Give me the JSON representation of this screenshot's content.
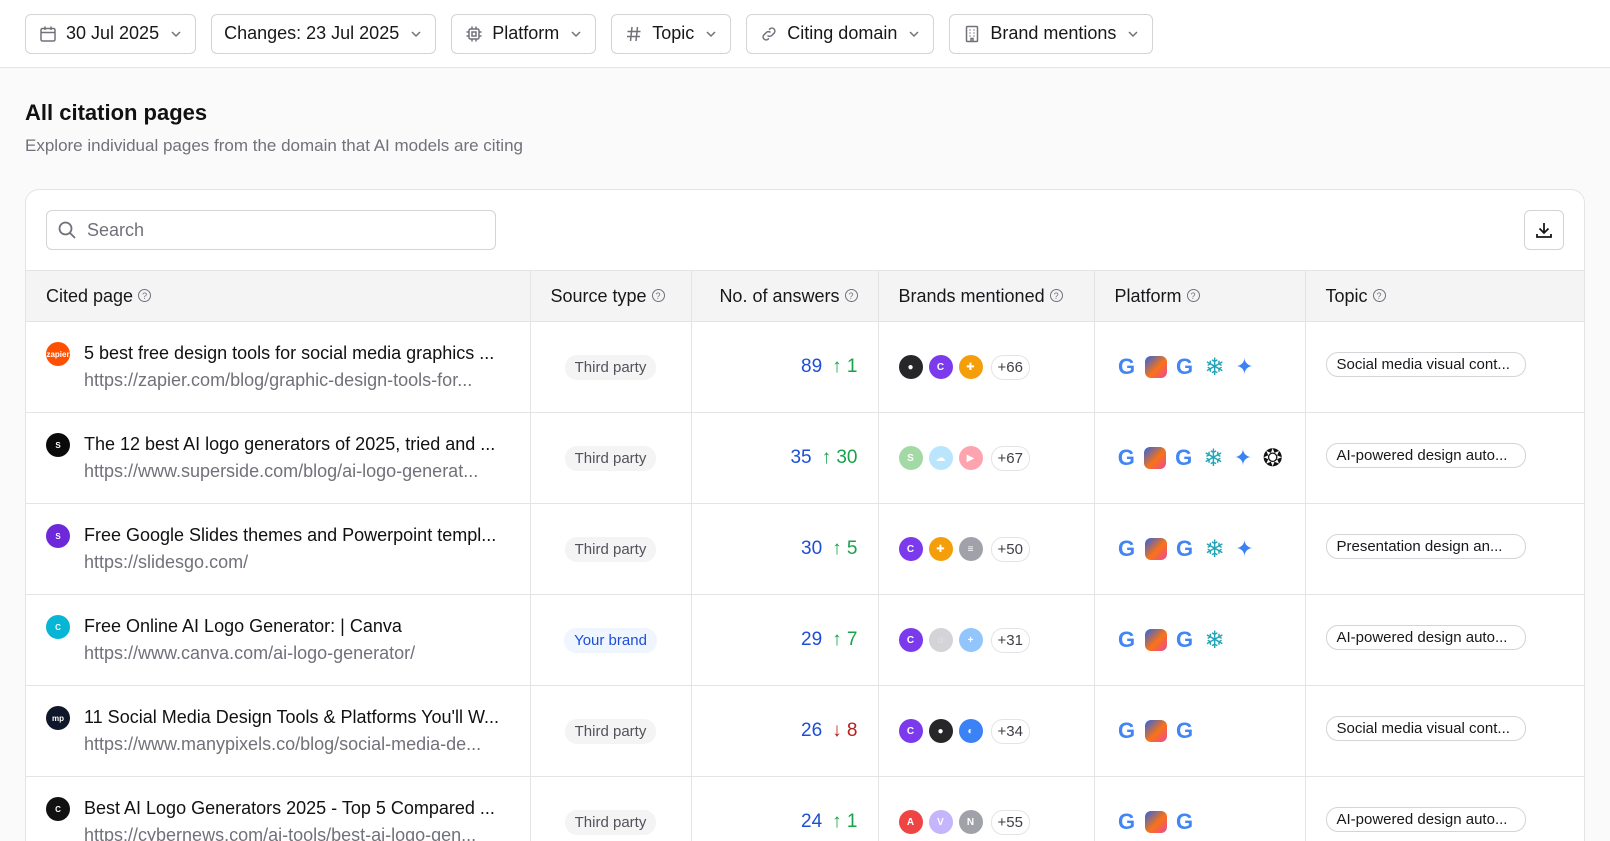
{
  "filters": [
    {
      "label": "30 Jul 2025",
      "icon": "calendar-icon"
    },
    {
      "label": "Changes: 23 Jul 2025",
      "icon": ""
    },
    {
      "label": "Platform",
      "icon": "chip-icon"
    },
    {
      "label": "Topic",
      "icon": "hash-icon"
    },
    {
      "label": "Citing domain",
      "icon": "link-icon"
    },
    {
      "label": "Brand mentions",
      "icon": "building-icon"
    }
  ],
  "section": {
    "title": "All citation pages",
    "subtitle": "Explore individual pages from the domain that AI models are citing"
  },
  "search": {
    "placeholder": "Search"
  },
  "columns": {
    "cited_page": "Cited page",
    "source_type": "Source type",
    "answers": "No. of answers",
    "brands": "Brands mentioned",
    "platform": "Platform",
    "topic": "Topic"
  },
  "rows": [
    {
      "title": "5 best free design tools for social media graphics ...",
      "url": "https://zapier.com/blog/graphic-design-tools-for...",
      "favicon": {
        "label": "zapier",
        "color": "#ff4f00"
      },
      "source": "Third party",
      "brand": false,
      "answers": "89",
      "delta": "1",
      "delta_dir": "up",
      "brand_icons": [
        {
          "color": "#27272a",
          "label": "●"
        },
        {
          "color": "#7c3aed",
          "label": "C"
        },
        {
          "color": "#f59e0b",
          "label": "✚"
        }
      ],
      "brands_more": "+66",
      "platforms": [
        "google",
        "copilot",
        "google",
        "perplexity",
        "gemini"
      ],
      "topic": "Social media visual cont..."
    },
    {
      "title": "The 12 best AI logo generators of 2025, tried and ...",
      "url": "https://www.superside.com/blog/ai-logo-generat...",
      "favicon": {
        "label": "S",
        "color": "#0a0a0a"
      },
      "source": "Third party",
      "brand": false,
      "answers": "35",
      "delta": "30",
      "delta_dir": "up",
      "brand_icons": [
        {
          "color": "#a3d9a5",
          "label": "S"
        },
        {
          "color": "#bae6fd",
          "label": "☁"
        },
        {
          "color": "#fda4af",
          "label": "▶"
        }
      ],
      "brands_more": "+67",
      "platforms": [
        "google",
        "copilot",
        "google",
        "perplexity",
        "gemini",
        "chatgpt"
      ],
      "topic": "AI-powered design auto..."
    },
    {
      "title": "Free Google Slides themes and Powerpoint templ...",
      "url": "https://slidesgo.com/",
      "favicon": {
        "label": "S",
        "color": "#6d28d9"
      },
      "source": "Third party",
      "brand": false,
      "answers": "30",
      "delta": "5",
      "delta_dir": "up",
      "brand_icons": [
        {
          "color": "#7c3aed",
          "label": "C"
        },
        {
          "color": "#f59e0b",
          "label": "✚"
        },
        {
          "color": "#a1a1aa",
          "label": "≡"
        }
      ],
      "brands_more": "+50",
      "platforms": [
        "google",
        "copilot",
        "google",
        "perplexity",
        "gemini"
      ],
      "topic": "Presentation design an..."
    },
    {
      "title": "Free Online AI Logo Generator: | Canva",
      "url": "https://www.canva.com/ai-logo-generator/",
      "favicon": {
        "label": "C",
        "color": "#06b6d4"
      },
      "source": "Your brand",
      "brand": true,
      "answers": "29",
      "delta": "7",
      "delta_dir": "up",
      "brand_icons": [
        {
          "color": "#7c3aed",
          "label": "C"
        },
        {
          "color": "#d4d4d8",
          "label": "◌"
        },
        {
          "color": "#93c5fd",
          "label": "+"
        }
      ],
      "brands_more": "+31",
      "platforms": [
        "google",
        "copilot",
        "google",
        "perplexity"
      ],
      "topic": "AI-powered design auto..."
    },
    {
      "title": "11 Social Media Design Tools & Platforms You'll W...",
      "url": "https://www.manypixels.co/blog/social-media-de...",
      "favicon": {
        "label": "mp",
        "color": "#0f172a"
      },
      "source": "Third party",
      "brand": false,
      "answers": "26",
      "delta": "8",
      "delta_dir": "down",
      "brand_icons": [
        {
          "color": "#7c3aed",
          "label": "C"
        },
        {
          "color": "#27272a",
          "label": "●"
        },
        {
          "color": "#3b82f6",
          "label": "◐"
        }
      ],
      "brands_more": "+34",
      "platforms": [
        "google",
        "copilot",
        "google"
      ],
      "topic": "Social media visual cont..."
    },
    {
      "title": "Best AI Logo Generators 2025 - Top 5 Compared ...",
      "url": "https://cybernews.com/ai-tools/best-ai-logo-gen...",
      "favicon": {
        "label": "C",
        "color": "#111111"
      },
      "source": "Third party",
      "brand": false,
      "answers": "24",
      "delta": "1",
      "delta_dir": "up",
      "brand_icons": [
        {
          "color": "#ef4444",
          "label": "A"
        },
        {
          "color": "#c4b5fd",
          "label": "V"
        },
        {
          "color": "#a1a1aa",
          "label": "N"
        }
      ],
      "brands_more": "+55",
      "platforms": [
        "google",
        "copilot",
        "google"
      ],
      "topic": "AI-powered design auto..."
    }
  ]
}
